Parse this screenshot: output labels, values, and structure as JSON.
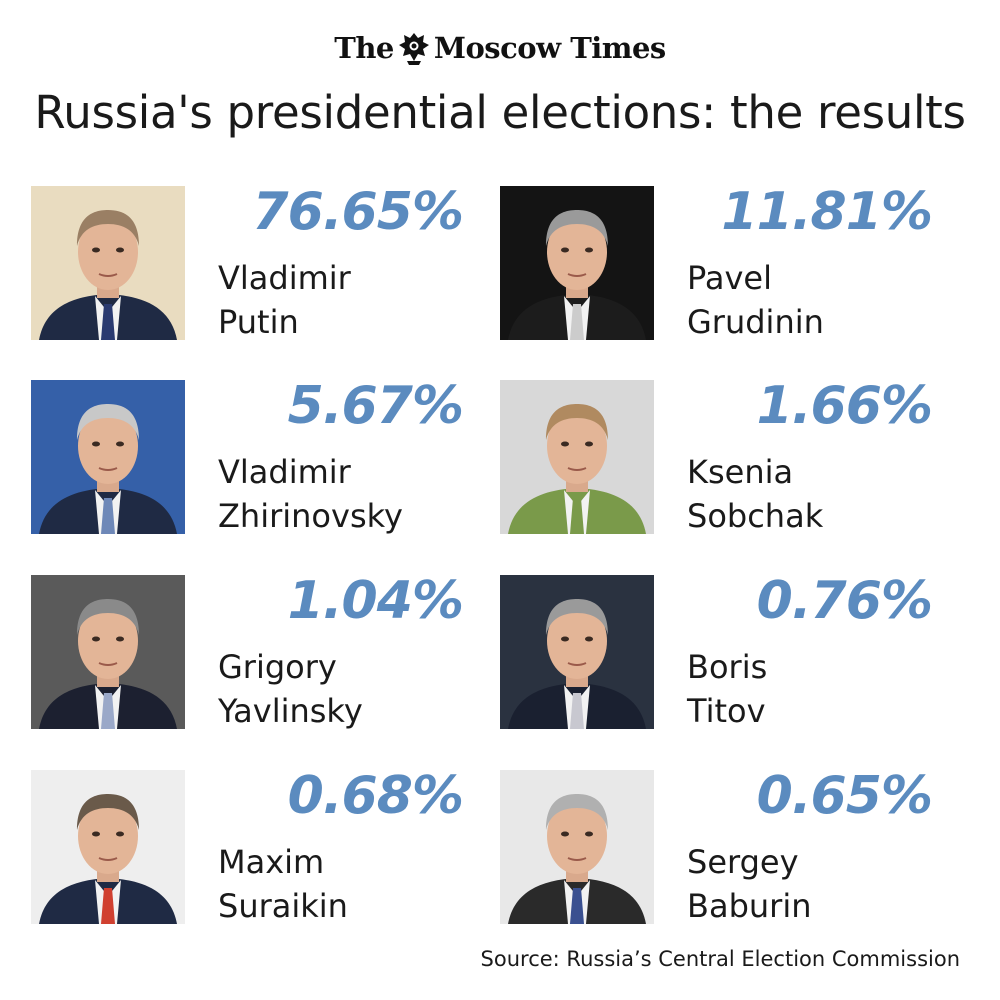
{
  "masthead": {
    "brand_left": "The",
    "brand_right": "Moscow Times",
    "emblem_icon": "coat-of-arms-icon"
  },
  "title": "Russia's presidential elections: the results",
  "accent_color": "#5b8bbf",
  "candidates": [
    {
      "first": "Vladimir",
      "last": "Putin",
      "percent": "76.65%",
      "photo": {
        "bg": "#e9dcc0",
        "suit": "#1f2a44",
        "tie": "#2a3a70",
        "hair": "#9a7f64"
      }
    },
    {
      "first": "Pavel",
      "last": "Grudinin",
      "percent": "11.81%",
      "photo": {
        "bg": "#141414",
        "suit": "#1c1c1c",
        "tie": "#cccccc",
        "hair": "#9a9a9a"
      }
    },
    {
      "first": "Vladimir",
      "last": "Zhirinovsky",
      "percent": "5.67%",
      "photo": {
        "bg": "#3560a8",
        "suit": "#1f2a44",
        "tie": "#6e88b8",
        "hair": "#c8c8c8"
      }
    },
    {
      "first": "Ksenia",
      "last": "Sobchak",
      "percent": "1.66%",
      "photo": {
        "bg": "#d8d8d8",
        "suit": "#7a9a4a",
        "tie": "#7a9a4a",
        "hair": "#b08a60"
      }
    },
    {
      "first": "Grigory",
      "last": "Yavlinsky",
      "percent": "1.04%",
      "photo": {
        "bg": "#5a5a5a",
        "suit": "#1c2030",
        "tie": "#9aa8c8",
        "hair": "#8a8a8a"
      }
    },
    {
      "first": "Boris",
      "last": "Titov",
      "percent": "0.76%",
      "photo": {
        "bg": "#2a3240",
        "suit": "#1a2030",
        "tie": "#c8c8d0",
        "hair": "#9a9a9a"
      }
    },
    {
      "first": "Maxim",
      "last": "Suraikin",
      "percent": "0.68%",
      "photo": {
        "bg": "#eeeeee",
        "suit": "#1f2a44",
        "tie": "#d04030",
        "hair": "#6a5a4a"
      }
    },
    {
      "first": "Sergey",
      "last": "Baburin",
      "percent": "0.65%",
      "photo": {
        "bg": "#e8e8e8",
        "suit": "#2a2a2a",
        "tie": "#3a5090",
        "hair": "#b0b0b0"
      }
    }
  ],
  "source": "Source: Russia’s Central Election Commission"
}
